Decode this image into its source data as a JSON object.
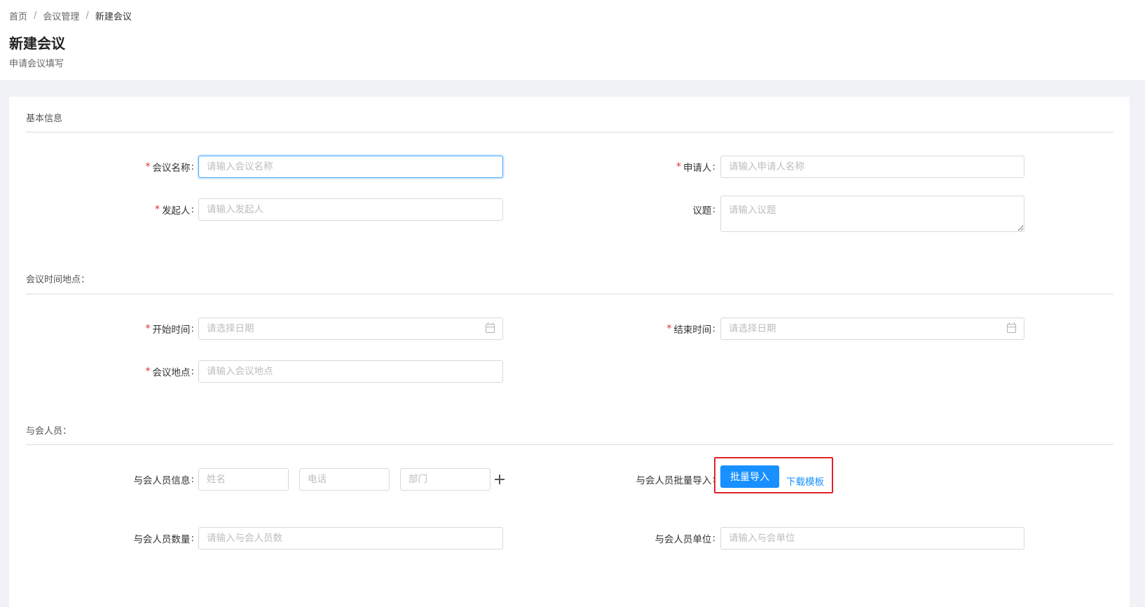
{
  "breadcrumb": {
    "home": "首页",
    "parent": "会议管理",
    "current": "新建会议",
    "separator": "/"
  },
  "page": {
    "title": "新建会议",
    "subtitle": "申请会议填写"
  },
  "sections": {
    "basic": "基本信息",
    "time_place": "会议时间地点：",
    "attendees": "与会人员："
  },
  "required_mark": "*",
  "fields": {
    "meeting_name": {
      "label": "会议名称",
      "placeholder": "请输入会议名称",
      "required": true
    },
    "applicant": {
      "label": "申请人",
      "placeholder": "请输入申请人名称",
      "required": true
    },
    "initiator": {
      "label": "发起人",
      "placeholder": "请输入发起人",
      "required": true
    },
    "topic": {
      "label": "议题",
      "placeholder": "请输入议题",
      "required": false
    },
    "start_time": {
      "label": "开始时间",
      "placeholder": "请选择日期",
      "required": true
    },
    "end_time": {
      "label": "结束时间",
      "placeholder": "请选择日期",
      "required": true
    },
    "location": {
      "label": "会议地点",
      "placeholder": "请输入会议地点",
      "required": true
    },
    "attendee_info": {
      "label": "与会人员信息",
      "name_placeholder": "姓名",
      "phone_placeholder": "电话",
      "dept_placeholder": "部门"
    },
    "batch_import": {
      "label": "与会人员批量导入",
      "button": "批量导入",
      "download_link": "下载模板"
    },
    "attendee_count": {
      "label": "与会人员数量",
      "placeholder": "请输入与会人员数"
    },
    "attendee_unit": {
      "label": "与会人员单位",
      "placeholder": "请输入与会单位"
    }
  },
  "colors": {
    "primary": "#1890ff",
    "required": "#e0312b",
    "highlight": "#e0242b"
  },
  "icons": [
    "calendar-icon",
    "plus-icon"
  ]
}
